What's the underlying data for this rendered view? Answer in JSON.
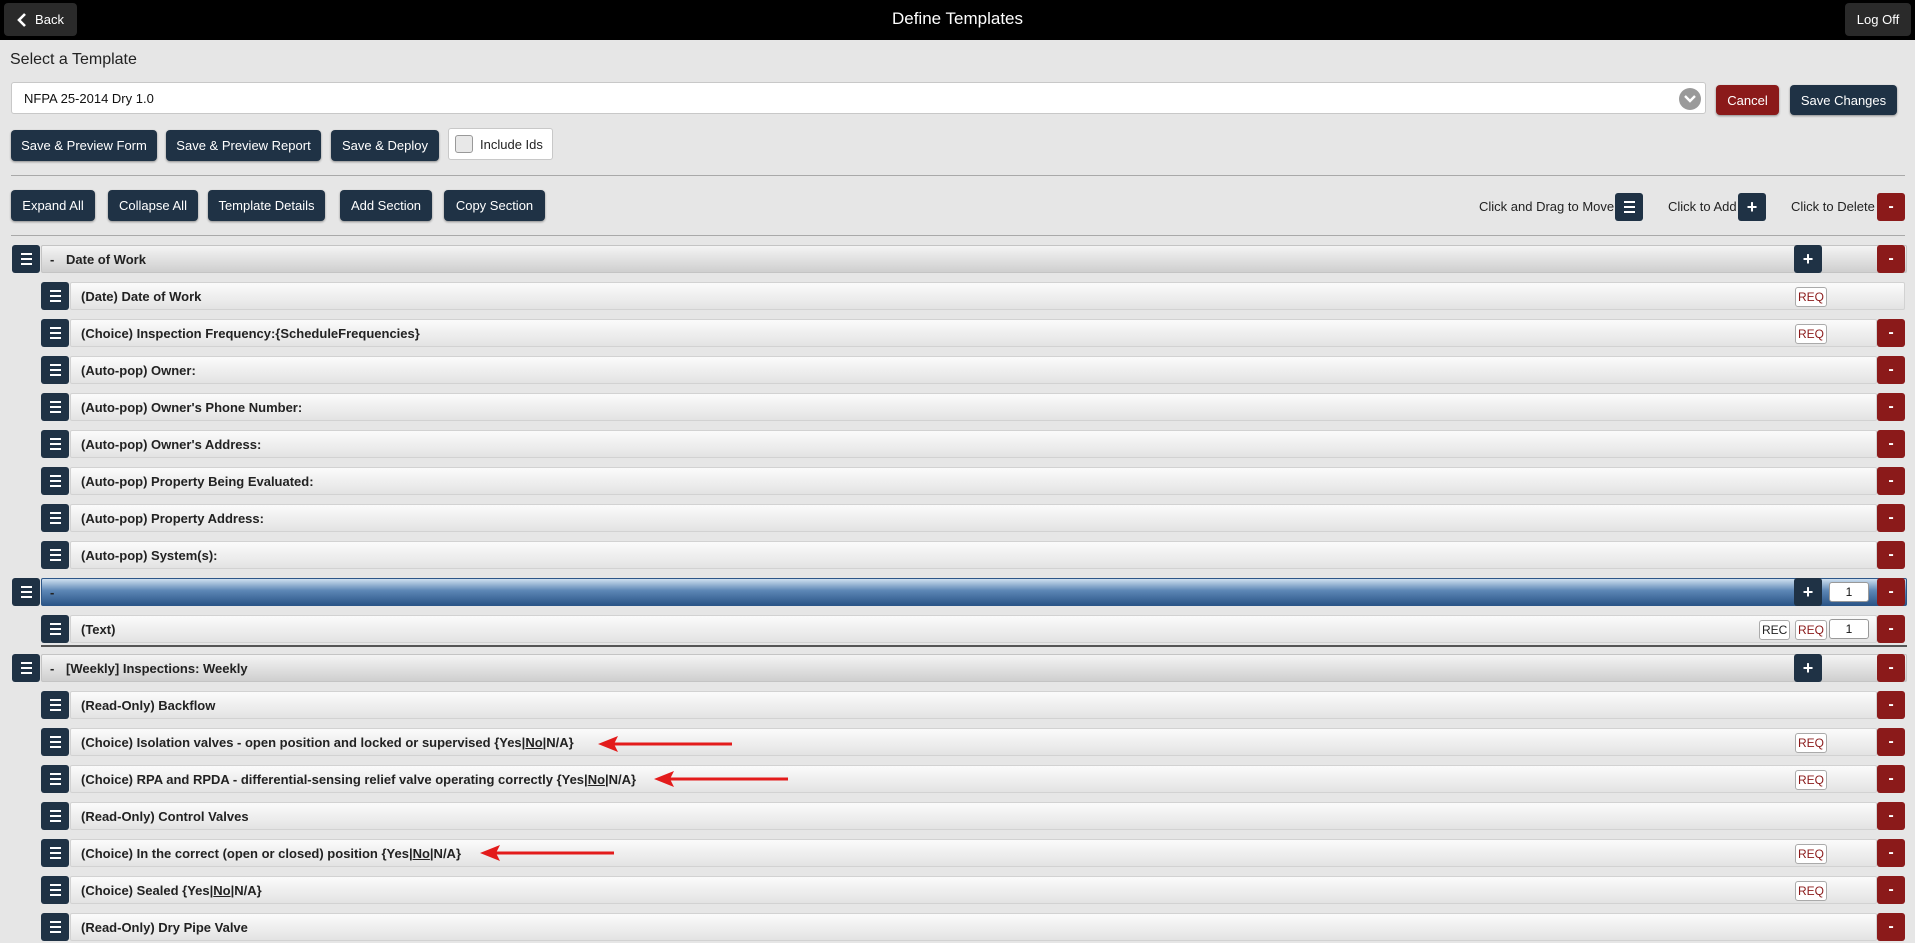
{
  "topbar": {
    "title": "Define Templates",
    "back_label": "Back",
    "logoff_label": "Log Off"
  },
  "template_select": {
    "heading": "Select a Template",
    "value": "NFPA 25-2014 Dry 1.0"
  },
  "actions": {
    "cancel": "Cancel",
    "save_changes": "Save Changes"
  },
  "preview_buttons": {
    "save_preview_form": "Save & Preview Form",
    "save_preview_report": "Save & Preview Report",
    "save_deploy": "Save & Deploy",
    "include_ids": "Include Ids"
  },
  "toolbar": {
    "expand_all": "Expand All",
    "collapse_all": "Collapse All",
    "template_details": "Template Details",
    "add_section": "Add Section",
    "copy_section": "Copy Section"
  },
  "legend": {
    "move": "Click and Drag to Move",
    "add": "Click to Add",
    "delete": "Click to Delete"
  },
  "icons": {
    "move": "hamburger-icon",
    "add": "plus-icon",
    "delete": "minus-icon",
    "back": "chevron-left-icon",
    "dropdown": "chevron-down-icon"
  },
  "colors": {
    "navy": "#1f3245",
    "red": "#8b1a1a",
    "blue_section": "#2c5688",
    "annotation_arrow": "#e31b1b"
  },
  "symbols": {
    "plus": "+",
    "minus": "-",
    "dash": "-"
  },
  "tags": {
    "req": "REQ",
    "rec": "REC"
  },
  "sections": [
    {
      "title": "Date of Work",
      "items": [
        {
          "text": "(Date) Date of Work",
          "req": true
        },
        {
          "text": "(Choice) Inspection Frequency:{ScheduleFrequencies}",
          "req": true
        },
        {
          "text": "(Auto-pop) Owner:"
        },
        {
          "text": "(Auto-pop) Owner's Phone Number:"
        },
        {
          "text": "(Auto-pop) Owner's Address:"
        },
        {
          "text": "(Auto-pop) Property Being Evaluated:"
        },
        {
          "text": "(Auto-pop) Property Address:"
        },
        {
          "text": "(Auto-pop) System(s):"
        }
      ]
    },
    {
      "title": "",
      "count": "1",
      "items": [
        {
          "text": "(Text)",
          "rec": true,
          "req": true,
          "count": "1"
        }
      ]
    },
    {
      "title": "[Weekly] Inspections: Weekly",
      "items": [
        {
          "text": "(Read-Only) Backflow"
        },
        {
          "text_pre": "(Choice) Isolation valves - open position and locked or supervised {Yes|",
          "text_u": "No",
          "text_post": "|N/A}",
          "req": true
        },
        {
          "text_pre": "(Choice) RPA and RPDA - differential-sensing relief valve operating correctly {Yes|",
          "text_u": "No",
          "text_post": "|N/A}",
          "req": true
        },
        {
          "text": "(Read-Only) Control Valves"
        },
        {
          "text_pre": "(Choice) In the correct (open or closed) position {Yes|",
          "text_u": "No",
          "text_post": "|N/A}",
          "req": true
        },
        {
          "text_pre": "(Choice) Sealed {Yes|",
          "text_u": "No",
          "text_post": "|N/A}",
          "req": true
        },
        {
          "text": "(Read-Only) Dry Pipe Valve"
        }
      ]
    }
  ]
}
